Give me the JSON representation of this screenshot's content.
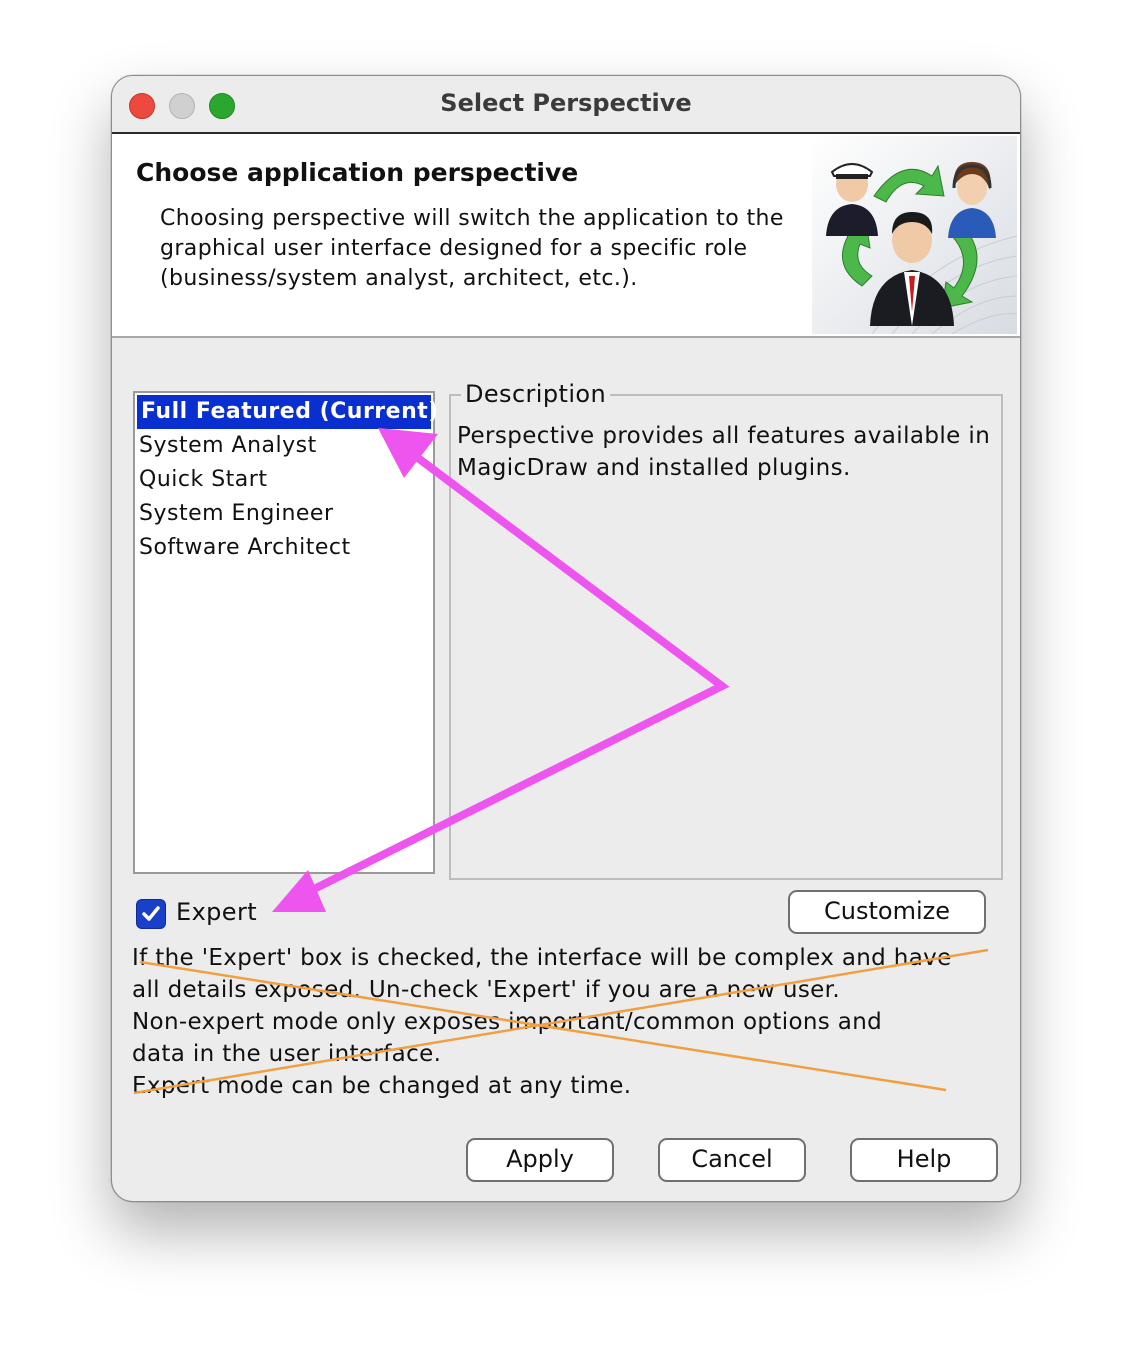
{
  "window": {
    "title": "Select Perspective",
    "controls": [
      "close-button",
      "minimize-button",
      "maximize-button"
    ]
  },
  "header": {
    "title": "Choose application perspective",
    "description": "Choosing perspective will switch the application to the graphical user interface designed for a specific role (business/system analyst, architect, etc.)."
  },
  "perspectives": {
    "items": [
      {
        "label": "Full Featured (Current)",
        "selected": true
      },
      {
        "label": "System Analyst",
        "selected": false
      },
      {
        "label": "Quick Start",
        "selected": false
      },
      {
        "label": "System Engineer",
        "selected": false
      },
      {
        "label": "Software Architect",
        "selected": false
      }
    ]
  },
  "description_panel": {
    "legend": "Description",
    "text": "Perspective provides all features available in MagicDraw and installed plugins."
  },
  "expert": {
    "label": "Expert",
    "checked": true
  },
  "info_text": {
    "lines": [
      "If the 'Expert' box is checked, the interface will be complex and have",
      "all details exposed. Un-check 'Expert' if you are a new user.",
      "Non-expert mode only exposes important/common options and",
      "data in the user interface.",
      "Expert mode can be changed at any time."
    ]
  },
  "buttons": {
    "customize": "Customize",
    "apply": "Apply",
    "cancel": "Cancel",
    "help": "Help"
  },
  "colors": {
    "selection": "#0a2fd0",
    "annotation_arrow": "#ee55ee",
    "annotation_strike": "#f0a040"
  },
  "icons": {
    "header_art": "roles-cycle-illustration"
  }
}
